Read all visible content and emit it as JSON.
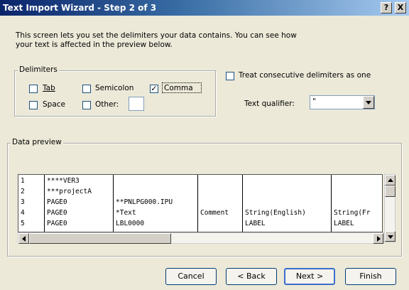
{
  "window": {
    "title": "Text Import Wizard - Step 2 of 3",
    "help_label": "?",
    "close_label": "X"
  },
  "intro": "This screen lets you set the delimiters your data contains.  You can see how your text is affected in the preview below.",
  "delimiters": {
    "legend": "Delimiters",
    "tab": {
      "label": "Tab",
      "checked": false
    },
    "semicolon": {
      "label": "Semicolon",
      "checked": false
    },
    "comma": {
      "label": "Comma",
      "checked": true
    },
    "space": {
      "label": "Space",
      "checked": false
    },
    "other": {
      "label": "Other:",
      "checked": false,
      "value": ""
    }
  },
  "consecutive": {
    "label": "Treat consecutive delimiters as one",
    "checked": false
  },
  "qualifier": {
    "label": "Text qualifier:",
    "value": "\""
  },
  "preview": {
    "legend": "Data preview",
    "rows": [
      [
        "1",
        "****VER3",
        "",
        "",
        "",
        ""
      ],
      [
        "2",
        "***projectA",
        "",
        "",
        "",
        ""
      ],
      [
        "3",
        "PAGE0",
        "**PNLPG000.IPU",
        "",
        "",
        ""
      ],
      [
        "4",
        "PAGE0",
        "*Text",
        "Comment",
        "String(English)",
        "String(Fr"
      ],
      [
        "5",
        "PAGE0",
        "LBL0000",
        "",
        "LABEL",
        "LABEL"
      ]
    ]
  },
  "buttons": {
    "cancel": "Cancel",
    "back": "< Back",
    "next": "Next >",
    "finish": "Finish"
  },
  "check_mark": "✓"
}
